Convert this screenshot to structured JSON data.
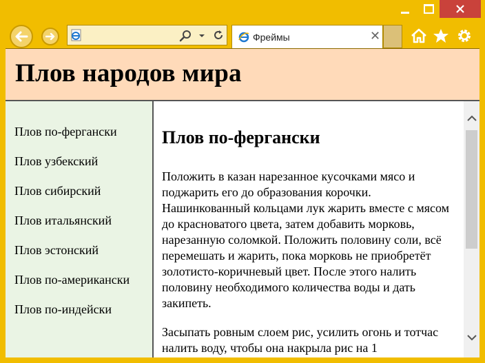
{
  "browser": {
    "tab_title": "Фреймы",
    "address_value": "",
    "icons": [
      "back-icon",
      "forward-icon",
      "ie-page-icon",
      "search-icon",
      "dropdown-icon",
      "refresh-icon",
      "close-icon",
      "home-icon",
      "favorites-icon",
      "settings-icon"
    ]
  },
  "header": {
    "title": "Плов народов мира"
  },
  "sidebar": {
    "items": [
      {
        "label": "Плов по-фергански"
      },
      {
        "label": "Плов узбекский"
      },
      {
        "label": "Плов сибирский"
      },
      {
        "label": "Плов итальянский"
      },
      {
        "label": "Плов эстонский"
      },
      {
        "label": "Плов по-американски"
      },
      {
        "label": "Плов по-индейски"
      }
    ]
  },
  "content": {
    "heading": "Плов по-фергански",
    "paragraphs": [
      "Положить в казан нарезанное кусочками мясо и поджарить его до образования корочки. Нашинкованный кольцами лук жарить вместе с мясом до красноватого цвета, затем добавить морковь, нарезанную соломкой. Положить половину соли, всё перемешать и жарить, пока морковь не приобретёт золотисто-коричневый цвет. После этого налить половину необходимого количества воды и дать закипеть.",
      "Засыпать ровным слоем рис, усилить огонь и тотчас налить воду, чтобы она накрыла рис на 1"
    ]
  },
  "colors": {
    "chrome": "#f1bd00",
    "header_bg": "#ffdab9",
    "sidebar_bg": "#eaf4e4",
    "close_btn": "#c9423b"
  }
}
